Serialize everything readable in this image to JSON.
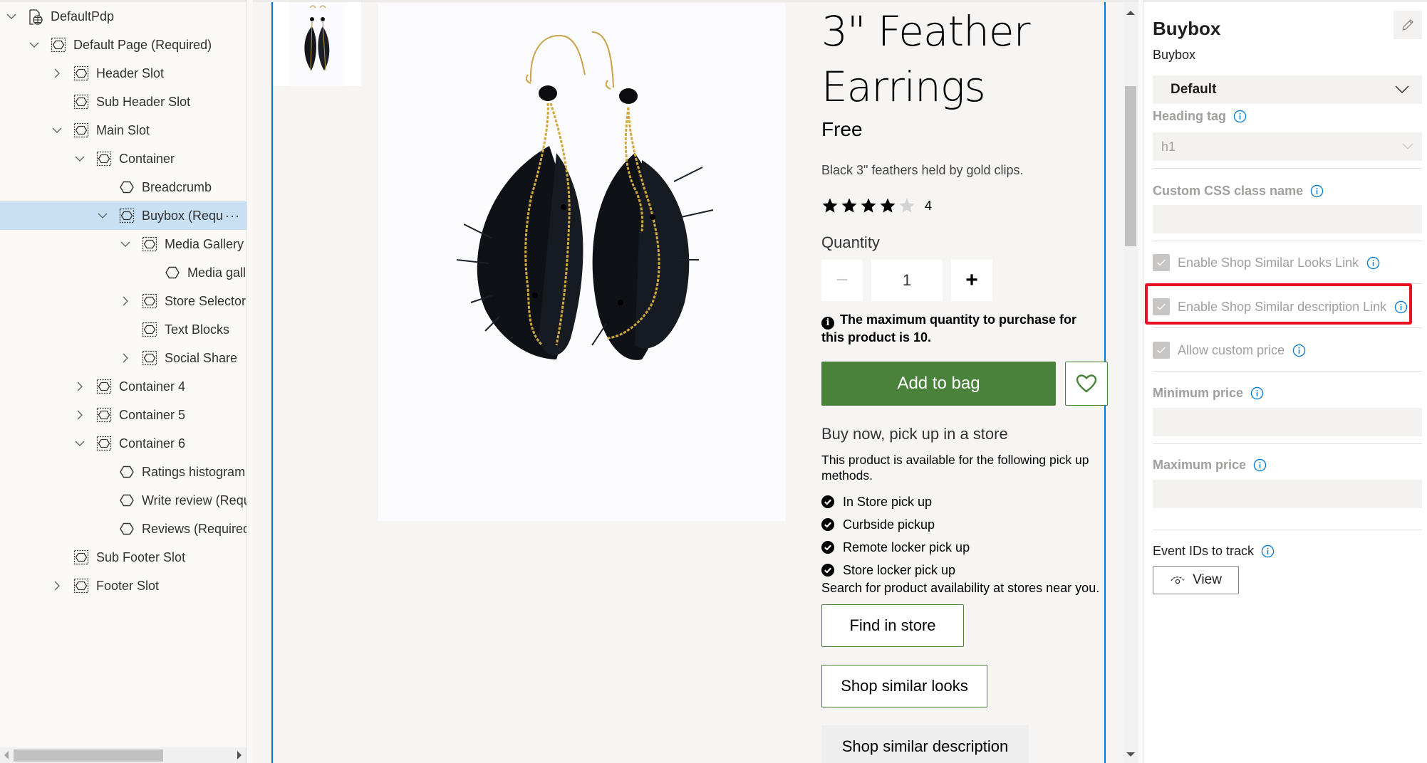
{
  "tree": {
    "nodes": [
      {
        "label": "DefaultPdp",
        "level": 0,
        "chevron": "down",
        "icon": "page-globe-icon",
        "type": "page"
      },
      {
        "label": "Default Page (Required)",
        "level": 1,
        "chevron": "down",
        "icon": "slot-icon",
        "type": "slot"
      },
      {
        "label": "Header Slot",
        "level": 2,
        "chevron": "right",
        "icon": "slot-icon",
        "type": "slot"
      },
      {
        "label": "Sub Header Slot",
        "level": 2,
        "chevron": "none",
        "icon": "slot-icon",
        "type": "slot"
      },
      {
        "label": "Main Slot",
        "level": 2,
        "chevron": "down",
        "icon": "slot-icon",
        "type": "slot"
      },
      {
        "label": "Container",
        "level": 3,
        "chevron": "down",
        "icon": "slot-icon",
        "type": "slot"
      },
      {
        "label": "Breadcrumb",
        "level": 4,
        "chevron": "none",
        "icon": "module-icon",
        "type": "module"
      },
      {
        "label": "Buybox (Requ",
        "level": 4,
        "chevron": "down",
        "icon": "slot-icon",
        "type": "slot",
        "selected": true,
        "more": "···"
      },
      {
        "label": "Media Gallery",
        "level": 5,
        "chevron": "down",
        "icon": "slot-icon",
        "type": "slot"
      },
      {
        "label": "Media gall",
        "level": 6,
        "chevron": "none",
        "icon": "module-icon",
        "type": "module"
      },
      {
        "label": "Store Selector",
        "level": 5,
        "chevron": "right",
        "icon": "slot-icon",
        "type": "slot"
      },
      {
        "label": "Text Blocks",
        "level": 5,
        "chevron": "none",
        "icon": "slot-icon",
        "type": "slot"
      },
      {
        "label": "Social Share",
        "level": 5,
        "chevron": "right",
        "icon": "slot-icon",
        "type": "slot"
      },
      {
        "label": "Container 4",
        "level": 3,
        "chevron": "right",
        "icon": "slot-icon",
        "type": "slot"
      },
      {
        "label": "Container 5",
        "level": 3,
        "chevron": "right",
        "icon": "slot-icon",
        "type": "slot"
      },
      {
        "label": "Container 6",
        "level": 3,
        "chevron": "down",
        "icon": "slot-icon",
        "type": "slot"
      },
      {
        "label": "Ratings histogram",
        "level": 4,
        "chevron": "none",
        "icon": "module-icon",
        "type": "module"
      },
      {
        "label": "Write review (Requ",
        "level": 4,
        "chevron": "none",
        "icon": "module-icon",
        "type": "module"
      },
      {
        "label": "Reviews (Required)",
        "level": 4,
        "chevron": "none",
        "icon": "module-icon",
        "type": "module"
      },
      {
        "label": "Sub Footer Slot",
        "level": 2,
        "chevron": "none",
        "icon": "slot-icon",
        "type": "slot"
      },
      {
        "label": "Footer Slot",
        "level": 2,
        "chevron": "right",
        "icon": "slot-icon",
        "type": "slot"
      }
    ]
  },
  "product": {
    "title": "3\" Feather Earrings",
    "price": "Free",
    "description": "Black 3\" feathers held by gold clips.",
    "rating": 4,
    "rating_max": 5,
    "rating_count": "4",
    "quantity_label": "Quantity",
    "quantity_value": "1",
    "minus_label": "−",
    "plus_label": "+",
    "max_note": "The maximum quantity to purchase for this product is 10.",
    "add_to_bag": "Add to bag",
    "pickup_title": "Buy now, pick up in a store",
    "pickup_text": "This product is available for the following pick up methods.",
    "pickup_methods": [
      "In Store pick up",
      "Curbside pickup",
      "Remote locker pick up",
      "Store locker pick up"
    ],
    "search_note": "Search for product availability at stores near you.",
    "find_in_store": "Find in store",
    "shop_similar_looks": "Shop similar looks",
    "shop_similar_description": "Shop similar description",
    "image_alt": "Black feather earrings with gold chains",
    "thumbnail_alt": "Feather earrings thumbnail"
  },
  "props": {
    "title": "Buybox",
    "subtitle": "Buybox",
    "layout_dropdown": "Default",
    "heading_tag_label": "Heading tag",
    "heading_tag_value": "h1",
    "css_class_label": "Custom CSS class name",
    "css_class_value": "",
    "checkboxes": [
      {
        "label": "Enable Shop Similar Looks Link",
        "checked": true
      },
      {
        "label": "Enable Shop Similar description Link",
        "checked": true,
        "highlighted": true
      },
      {
        "label": "Allow custom price",
        "checked": true
      }
    ],
    "min_price_label": "Minimum price",
    "min_price_value": "",
    "max_price_label": "Maximum price",
    "max_price_value": "",
    "event_ids_label": "Event IDs to track",
    "view_button": "View"
  },
  "colors": {
    "accent_green": "#4a813b",
    "selection_blue": "#c7e0f4",
    "frame_blue": "#0078d4",
    "highlight_red": "#e81123",
    "info_blue": "#0078d4"
  }
}
